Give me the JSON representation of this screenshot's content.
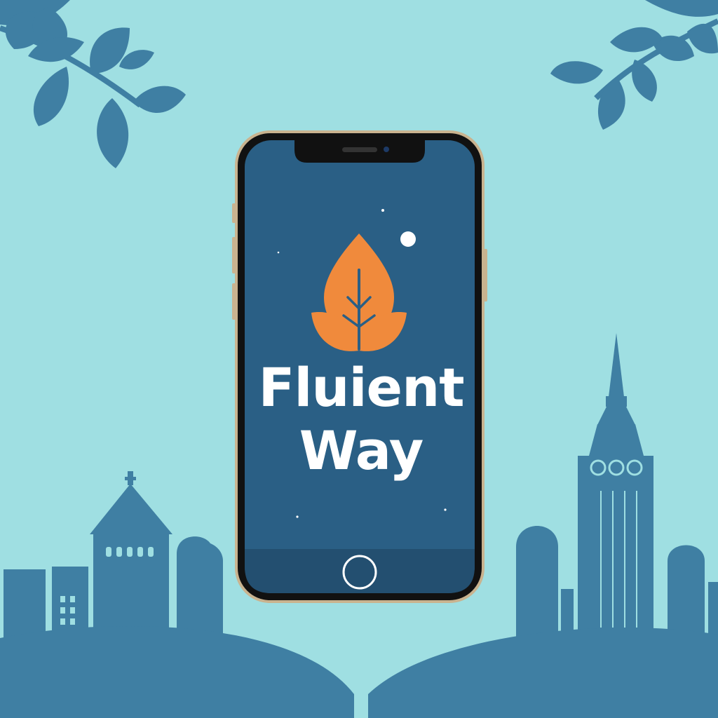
{
  "app": {
    "name_line_1": "Fluient",
    "name_line_2": "Way"
  },
  "icons": {
    "logo": "leaf-flame-icon",
    "home_button": "home-button-icon",
    "front_camera": "camera-icon"
  },
  "colors": {
    "background": "#9fdfe2",
    "silhouette": "#3f7fa3",
    "screen": "#2a5f85",
    "screen_bottom_bar": "#234f70",
    "logo": "#f08a3c",
    "bezel": "#111111",
    "frame": "#c9b38f",
    "title_text": "#ffffff"
  }
}
